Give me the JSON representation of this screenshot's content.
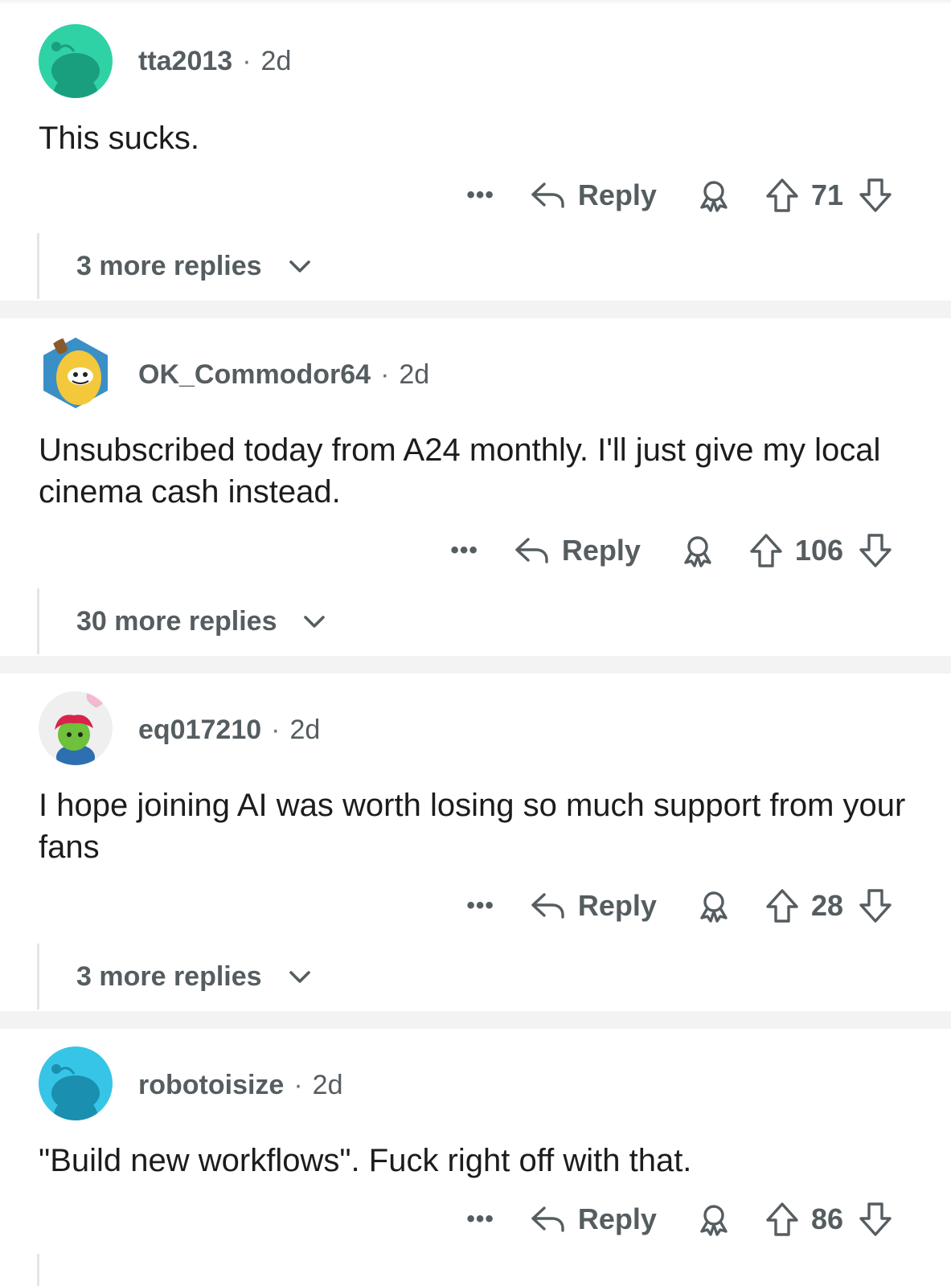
{
  "comments": [
    {
      "username": "tta2013",
      "age": "2d",
      "text": "This sucks.",
      "score": "71",
      "reply_label": "Reply",
      "more_replies": "3 more replies",
      "avatar_icon": "snoo-avatar-teal"
    },
    {
      "username": "OK_Commodor64",
      "age": "2d",
      "text": "Unsubscribed today from A24 monthly.  I'll just give my local cinema cash instead.",
      "score": "106",
      "reply_label": "Reply",
      "more_replies": "30 more replies",
      "avatar_icon": "banana-avatar"
    },
    {
      "username": "eq017210",
      "age": "2d",
      "text": "I hope joining AI was worth losing so much support from your fans",
      "score": "28",
      "reply_label": "Reply",
      "more_replies": "3 more replies",
      "avatar_icon": "green-character-avatar"
    },
    {
      "username": "robotoisize",
      "age": "2d",
      "text": "\"Build new workflows\". Fuck right off with that.",
      "score": "86",
      "reply_label": "Reply",
      "avatar_icon": "snoo-avatar-cyan"
    }
  ],
  "separator_dot": "·",
  "more_options_label": "•••",
  "colors": {
    "meta_text": "#555d61",
    "body_text": "#1c1c1c",
    "separator": "#f3f3f3"
  }
}
